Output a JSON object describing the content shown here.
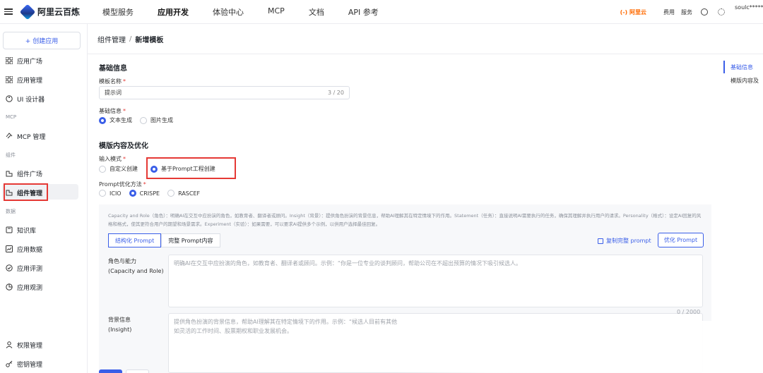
{
  "app": {
    "name": "阿里云百炼"
  },
  "nav": [
    "模型服务",
    "应用开发",
    "体验中心",
    "MCP",
    "文档",
    "API 参考"
  ],
  "nav_active": "应用开发",
  "top_right": {
    "brand": "(-) 阿里云",
    "fees": "费用",
    "service": "服务",
    "user": "soulc*****@"
  },
  "sidebar": {
    "create": "+ 创建应用",
    "items": [
      {
        "label": "应用广场",
        "icon": "grid-icon"
      },
      {
        "label": "应用管理",
        "icon": "grid-icon"
      },
      {
        "label": "UI 设计器",
        "icon": "palette-icon"
      },
      {
        "label": "MCP 管理",
        "icon": "mcp-icon"
      },
      {
        "label": "组件广场",
        "icon": "component-icon"
      },
      {
        "label": "组件管理",
        "icon": "component-icon"
      },
      {
        "label": "知识库",
        "icon": "book-icon"
      },
      {
        "label": "应用数据",
        "icon": "chart-icon"
      },
      {
        "label": "应用评测",
        "icon": "eval-icon"
      },
      {
        "label": "应用观测",
        "icon": "observe-icon"
      },
      {
        "label": "权限管理",
        "icon": "user-icon"
      },
      {
        "label": "密钥管理",
        "icon": "key-icon"
      }
    ],
    "sections": {
      "mcp": "MCP",
      "components": "组件",
      "data": "数据"
    }
  },
  "breadcrumb": {
    "parent": "组件管理",
    "sep": "/",
    "current": "新增模板"
  },
  "anchors": [
    "基础信息",
    "模版内容及"
  ],
  "form": {
    "basic_title": "基础信息",
    "name_label": "模板名称",
    "name_value": "提示词",
    "name_count": "3 / 20",
    "type_label": "基础信息",
    "type_options": [
      "文本生成",
      "图片生成"
    ],
    "type_selected": "文本生成",
    "content_title": "模版内容及优化",
    "input_mode_label": "输入模式",
    "input_mode_options": [
      "自定义创建",
      "基于Prompt工程创建"
    ],
    "input_mode_selected": "基于Prompt工程创建",
    "method_label": "Prompt优化方法",
    "method_options": [
      "ICIO",
      "CRISPE",
      "RASCEF"
    ],
    "method_selected": "CRISPE",
    "required_mark": "*"
  },
  "panel": {
    "hint": "Capacity and Role（角色）：明确AI在交互中应扮演的角色，如教育者、翻译者或顾问。Insight（背景）：提供角色扮演的背景信息，帮助AI理解其在特定情境下的作用。Statement（任务）：直接说明AI需要执行的任务，确保其理解并执行用户的请求。Personality（格式）：设定AI回复的风格和格式，使其更符合用户的期望和场景需求。Experiment（实验）：如果需要，可以要求AI提供多个示例，以供用户选择最佳回复。",
    "tabs": [
      "结构化 Prompt",
      "完整 Prompt内容"
    ],
    "tab_active": "结构化 Prompt",
    "copy": "复制完整 prompt",
    "optimize": "优化 Prompt",
    "fields": [
      {
        "label1": "角色与能力",
        "label2": "(Capacity and Role)",
        "placeholder": "明确AI在交互中应扮演的角色，如教育者、翻译者或顾问。示例：“你是一位专业的谈判顾问，帮助公司在不超出预算的情况下吸引候选人。"
      },
      {
        "label1": "背景信息",
        "label2": "(Insight)",
        "placeholder": "提供角色扮演的背景信息，帮助AI理解其在特定情境下的作用。示例：“候选人目前有其他\n如灵活的工作时间、股票期权和职业发展机会。"
      }
    ],
    "count": "0 / 2000"
  }
}
